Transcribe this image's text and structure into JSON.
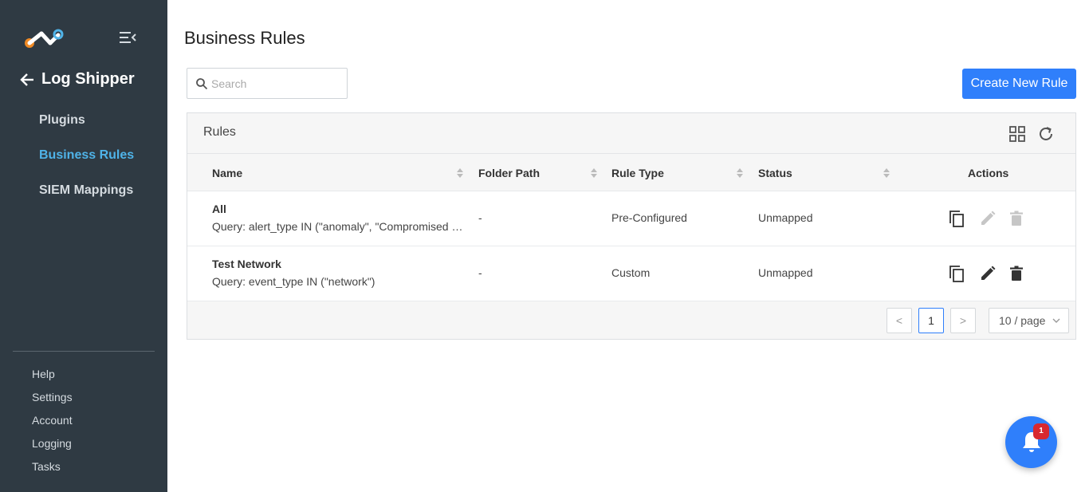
{
  "sidebar": {
    "app_title": "Log Shipper",
    "nav": [
      {
        "label": "Plugins",
        "active": false
      },
      {
        "label": "Business Rules",
        "active": true
      },
      {
        "label": "SIEM Mappings",
        "active": false
      }
    ],
    "bottom": [
      "Help",
      "Settings",
      "Account",
      "Logging",
      "Tasks"
    ],
    "colors": {
      "background": "#2f3a43",
      "active": "#4fb3e8"
    }
  },
  "page": {
    "title": "Business Rules",
    "search_placeholder": "Search",
    "create_button": "Create New Rule"
  },
  "card": {
    "title": "Rules",
    "header_icons": [
      "grid-view-icon",
      "refresh-icon"
    ]
  },
  "table": {
    "columns": [
      "Name",
      "Folder Path",
      "Rule Type",
      "Status",
      "Actions"
    ],
    "rows": [
      {
        "name": "All",
        "query": "Query: alert_type IN (\"anomaly\", \"Compromised Credentials\")",
        "folder": "-",
        "type": "Pre-Configured",
        "status": "Unmapped",
        "actions": {
          "copy": true,
          "edit": false,
          "delete": false
        }
      },
      {
        "name": "Test Network",
        "query": "Query: event_type IN (\"network\")",
        "folder": "-",
        "type": "Custom",
        "status": "Unmapped",
        "actions": {
          "copy": true,
          "edit": true,
          "delete": true
        }
      }
    ]
  },
  "pagination": {
    "prev": "<",
    "page": "1",
    "next": ">",
    "page_size": "10 / page"
  },
  "notifications": {
    "count": "1"
  },
  "colors": {
    "primary": "#2f7ffb",
    "badge": "#d8282f"
  }
}
